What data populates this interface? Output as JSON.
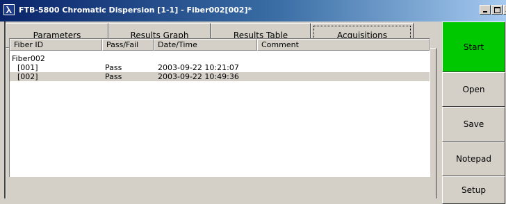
{
  "window": {
    "title": "FTB-5800 Chromatic Dispersion  [1-1] - Fiber002[002]*",
    "app_icon": "lambda-icon",
    "close_glyph": "X"
  },
  "tabs": [
    {
      "label": "Parameters"
    },
    {
      "label": "Results Graph"
    },
    {
      "label": "Results Table"
    },
    {
      "label": "Acquisitions",
      "active": true
    }
  ],
  "list": {
    "columns": [
      "Fiber ID",
      "Pass/Fail",
      "Date/Time",
      "Comment"
    ],
    "group": "Fiber002",
    "rows": [
      {
        "id": "[001]",
        "status": "Pass",
        "datetime": "2003-09-22 10:21:07",
        "comment": ""
      },
      {
        "id": "[002]",
        "status": "Pass",
        "datetime": "2003-09-22 10:49:36",
        "comment": "",
        "selected": true
      }
    ]
  },
  "sidebar": {
    "start": "Start",
    "open": "Open",
    "save": "Save",
    "notepad": "Notepad",
    "setup": "Setup"
  },
  "colors": {
    "start_button": "#00c800",
    "title_bar": "#0a246a",
    "face": "#d4d0c8"
  }
}
